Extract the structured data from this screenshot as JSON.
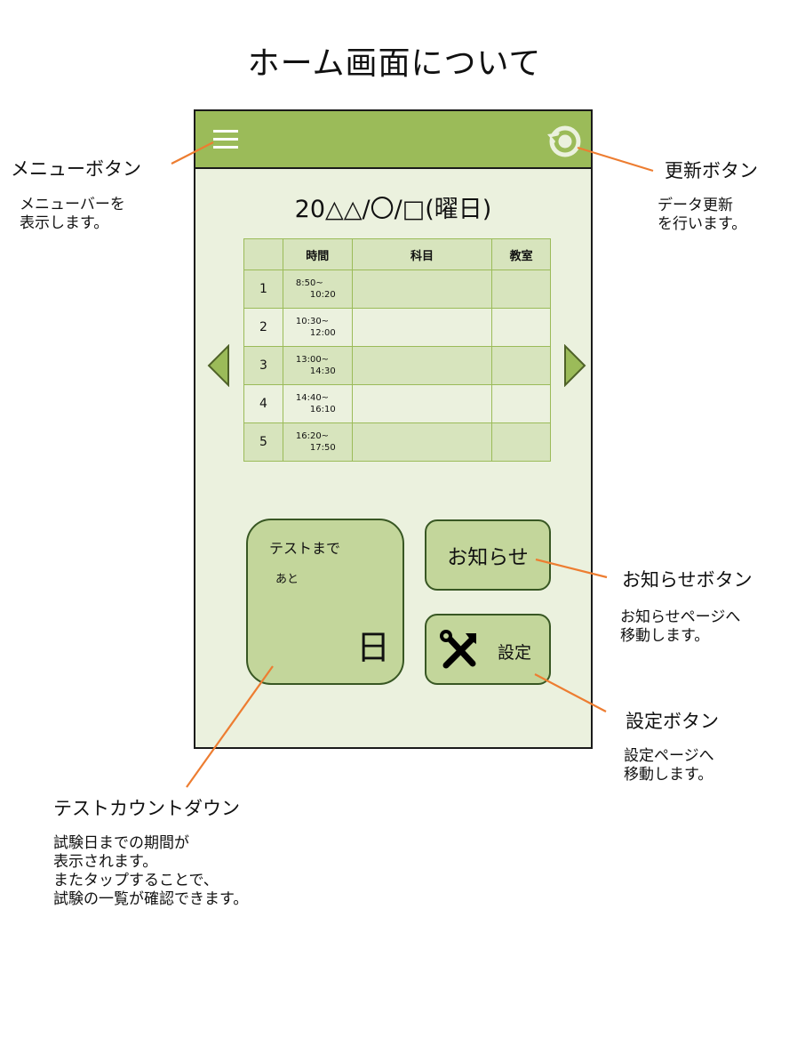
{
  "page_title": "ホーム画面について",
  "app": {
    "date_heading": "20△△/〇/□(曜日)",
    "table": {
      "headers": [
        "",
        "時間",
        "科目",
        "教室"
      ],
      "rows": [
        {
          "period": "1",
          "time_start": "8:50~",
          "time_end": "10:20",
          "subject": "",
          "room": ""
        },
        {
          "period": "2",
          "time_start": "10:30~",
          "time_end": "12:00",
          "subject": "",
          "room": ""
        },
        {
          "period": "3",
          "time_start": "13:00~",
          "time_end": "14:30",
          "subject": "",
          "room": ""
        },
        {
          "period": "4",
          "time_start": "14:40~",
          "time_end": "16:10",
          "subject": "",
          "room": ""
        },
        {
          "period": "5",
          "time_start": "16:20~",
          "time_end": "17:50",
          "subject": "",
          "room": ""
        }
      ]
    },
    "countdown": {
      "label": "テストまで",
      "sub": "あと",
      "unit": "日"
    },
    "notice_button": "お知らせ",
    "settings_button": "設定"
  },
  "annotations": {
    "menu": {
      "title": "メニューボタン",
      "desc": "メニューバーを\n表示します。"
    },
    "refresh": {
      "title": "更新ボタン",
      "desc": "データ更新\nを行います。"
    },
    "notice": {
      "title": "お知らせボタン",
      "desc": "お知らせページへ\n移動します。"
    },
    "settings": {
      "title": "設定ボタン",
      "desc": "設定ページへ\n移動します。"
    },
    "countdown": {
      "title": "テストカウントダウン",
      "desc": "試験日までの期間が\n表示されます。\nまたタップすることで、\n試験の一覧が確認できます。"
    }
  },
  "colors": {
    "appbar": "#9bbb59",
    "screen_bg": "#ebf1de",
    "button": "#c3d69b",
    "leader": "#ed7d31"
  }
}
